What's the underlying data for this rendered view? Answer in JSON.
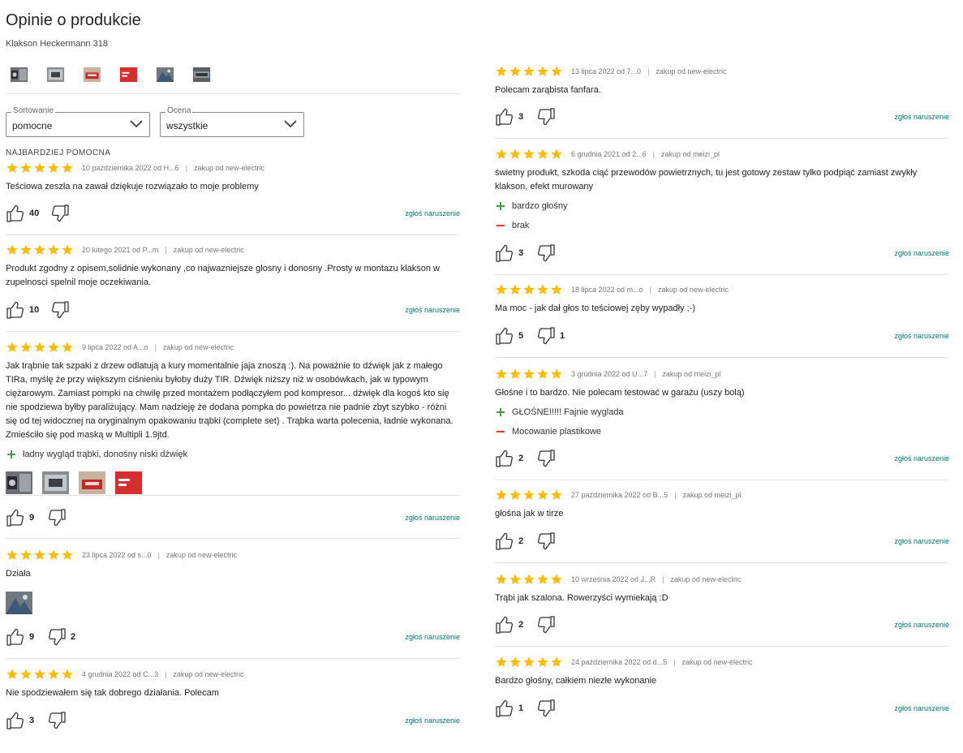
{
  "header": {
    "title": "Opinie o produkcie",
    "product": "Klakson Heckermann 318"
  },
  "filters": {
    "sort": {
      "legend": "Sortowanie",
      "value": "pomocne"
    },
    "rating": {
      "legend": "Ocena",
      "value": "wszystkie"
    }
  },
  "section_tag": "NAJBARDZIEJ POMOCNA",
  "report_label": "zgłoś naruszenie",
  "colors": {
    "star": "#fbbc05",
    "accent": "#00796b",
    "pro": "#43a047",
    "con": "#e53935"
  },
  "icons": {
    "star": "star-icon",
    "thumb_up": "thumb-up-icon",
    "thumb_down": "thumb-down-icon",
    "chevron": "chevron-down-icon",
    "pro": "plus-icon",
    "con": "minus-icon"
  },
  "reviews": [
    {
      "rating": 5,
      "date": "10 października 2022 od H...6",
      "source": "zakup od new-electric",
      "text": "Teściowa zeszła na zawał dziękuje rozwiązało to moje problemy",
      "up": "40",
      "down": ""
    },
    {
      "rating": 5,
      "date": "20 lutego 2021 od P...m",
      "source": "zakup od new-electric",
      "text": "Produkt zgodny z opisem,solidnie wykonany ,co najwazniejsze glosny i donosny .Prosty w montazu klakson w zupelnosci spelnil moje oczekiwania.",
      "up": "10",
      "down": ""
    },
    {
      "rating": 5,
      "date": "9 lipca 2022 od A...o",
      "source": "zakup od new-electric",
      "text": "Jak trąbnie tak szpaki z drzew odlatują a kury momentalnie jaja znoszą :). Na poważnie to dźwięk jak z małego TIRa, myślę że przy większym ciśnieniu byłoby duży TIR. Dźwięk niższy niż w osobówkach, jak w typowym ciężarowym. Zamiast pompki na chwilę przed montażem podłączyłem pod kompresor... dźwięk dla kogoś kto się nie spodziewa byłby paraliżujący. Mam nadzieję że dodana pompka do powietrza nie padnie zbyt szybko - różni się od tej widocznej na oryginalnym opakowaniu trąbki (complete set) . Trąbka warta polecenia, ładnie wykonana. Zmieściło się pod maską w Multipli 1.9jtd.",
      "pros": [
        "ładny wygląd trąbki, donośny niski dźwięk"
      ],
      "up": "9",
      "down": ""
    },
    {
      "rating": 5,
      "date": "23 lipca 2022 od s...0",
      "source": "zakup od new-electric",
      "text": "Działa",
      "up": "9",
      "down": "2"
    },
    {
      "rating": 5,
      "date": "4 grudnia 2022 od C...3",
      "source": "zakup od new-electric",
      "text": "Nie spodziewałem się tak dobrego działania. Polecam",
      "up": "3",
      "down": ""
    },
    {
      "rating": 5,
      "date": "13 lipca 2022 od 7...0",
      "source": "zakup od new-electric",
      "text": "Polecam zarąbista fanfara.",
      "up": "3",
      "down": ""
    },
    {
      "rating": 5,
      "date": "6 grudnia 2021 od 2...6",
      "source": "zakup od meizi_pl",
      "text": "świetny produkt, szkoda ciąć przewodów powietrznych, tu jest gotowy zestaw tylko podpiąć zamiast zwykły klakson, efekt murowany",
      "pros": [
        "bardzo głośny"
      ],
      "cons": [
        "brak"
      ],
      "up": "3",
      "down": ""
    },
    {
      "rating": 5,
      "date": "18 lipca 2022 od m...o",
      "source": "zakup od new-electric",
      "text": "Ma moc - jak dał głos to teściowej zęby wypadły ;-)",
      "up": "5",
      "down": "1"
    },
    {
      "rating": 5,
      "date": "3 grudnia 2022 od U...7",
      "source": "zakup od meizi_pl",
      "text": "Głośne i to bardzo. Nie polecam testować w garażu (uszy bolą)",
      "pros": [
        "GŁOŚNE!!!!! Fajnie wyglada"
      ],
      "cons": [
        "Mocowanie plastikowe"
      ],
      "up": "2",
      "down": ""
    },
    {
      "rating": 5,
      "date": "27 października 2022 od B...5",
      "source": "zakup od meizi_pl",
      "text": "głośna jak w tirze",
      "up": "2",
      "down": ""
    },
    {
      "rating": 5,
      "date": "10 września 2022 od J...R",
      "source": "zakup od new-electric",
      "text": "Trąbi jak szalona. Rowerzyści wymiekają :D",
      "up": "2",
      "down": ""
    },
    {
      "rating": 5,
      "date": "24 października 2022 od d...5",
      "source": "zakup od new-electric",
      "text": "Bardzo głośny, całkiem niezłe wykonanie",
      "up": "1",
      "down": ""
    }
  ]
}
